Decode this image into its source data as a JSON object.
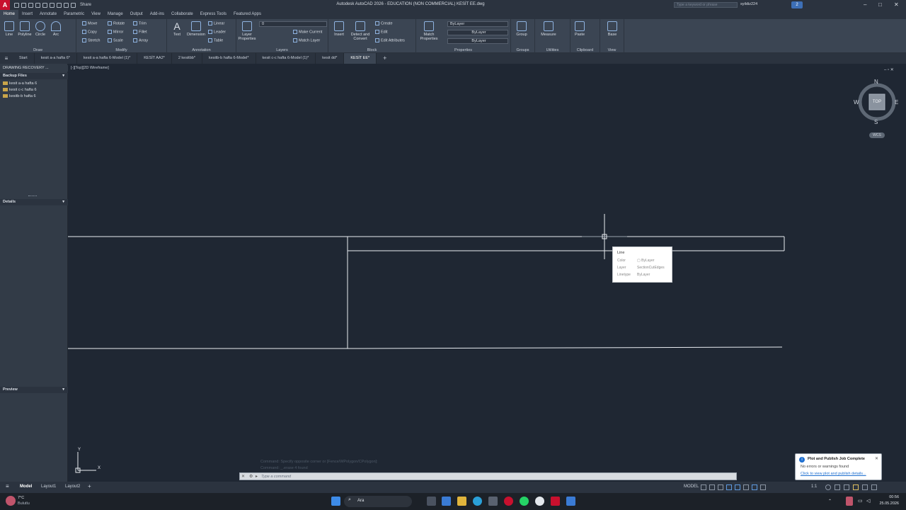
{
  "app": {
    "logo": "A",
    "title": "Autodesk AutoCAD 2026 - EDUCATION (NON COMMERCIAL)    KESİT EE.dwg",
    "share_label": "Share",
    "search_placeholder": "Type a keyword or phrase",
    "user": "syildiz224",
    "notif_badge": "2"
  },
  "ribbon_tabs": [
    "Home",
    "Insert",
    "Annotate",
    "Parametric",
    "View",
    "Manage",
    "Output",
    "Add-ins",
    "Collaborate",
    "Express Tools",
    "Featured Apps"
  ],
  "ribbon": {
    "draw": {
      "label": "Draw",
      "buttons": [
        "Line",
        "Polyline",
        "Circle",
        "Arc"
      ]
    },
    "modify": {
      "label": "Modify",
      "rows": [
        "Move",
        "Rotate",
        "Trim",
        "Copy",
        "Mirror",
        "Fillet",
        "Stretch",
        "Scale",
        "Array"
      ]
    },
    "annotation": {
      "label": "Annotation",
      "buttons": [
        "Text",
        "Dimension"
      ],
      "rows": [
        "Linear",
        "Leader",
        "Table"
      ]
    },
    "layers": {
      "label": "Layers",
      "props_label": "Layer Properties",
      "layer_value": "0",
      "rows": [
        "Make Current",
        "Match Layer"
      ]
    },
    "block": {
      "label": "Block",
      "buttons": [
        "Insert",
        "Detect and Convert"
      ],
      "rows": [
        "Create",
        "Edit",
        "Edit Attributes"
      ]
    },
    "properties": {
      "label": "Properties",
      "match_label": "Match Properties",
      "color": "ByLayer",
      "lineweight": "ByLayer",
      "linetype": "ByLayer"
    },
    "groups": {
      "label": "Groups",
      "button": "Group"
    },
    "utilities": {
      "label": "Utilities",
      "button": "Measure"
    },
    "clipboard": {
      "label": "Clipboard",
      "button": "Paste"
    },
    "view": {
      "label": "View",
      "button": "Base"
    }
  },
  "file_tabs": [
    "Start",
    "kesit a-a hafta 6*",
    "kesit a-a hafta 6-Model (1)*",
    "KESİT AA2*",
    "2 kesitbb*",
    "kesitb-b hafta 6-Model*",
    "kesit c-c hafta 6-Model (1)*",
    "kesit dd*",
    "KESİT EE*"
  ],
  "left_palette": {
    "title": "DRAWING RECOVERY ...",
    "backup_header": "Backup Files",
    "backup_files": [
      "kesit a-a hafta 6",
      "kesit c-c hafta 6",
      "kesitb-b hafta 6"
    ],
    "details_header": "Details",
    "preview_header": "Preview"
  },
  "viewport": {
    "label": "[-][Top][2D Wireframe]"
  },
  "viewcube": {
    "n": "N",
    "s": "S",
    "e": "E",
    "w": "W",
    "face": "TOP",
    "wcs": "WCS"
  },
  "tooltip": {
    "title": "Line",
    "rows": [
      {
        "key": "Color",
        "value": "ByLayer"
      },
      {
        "key": "Layer",
        "value": "SectionCutEdges"
      },
      {
        "key": "Linetype",
        "value": "ByLayer"
      }
    ]
  },
  "ucs": {
    "x": "X",
    "y": "Y"
  },
  "command": {
    "history": [
      "Command: Specify opposite corner or [Fence/WPolygon/CPolygon]:",
      "Command: _.erase 4 found"
    ],
    "placeholder": "Type a command"
  },
  "layout_tabs": [
    "Model",
    "Layout1",
    "Layout2"
  ],
  "status": {
    "model_label": "MODEL",
    "scale": "1:1"
  },
  "notification": {
    "title": "Plot and Publish Job Complete",
    "line1": "No errors or warnings found",
    "link": "Click to view plot and publish details..."
  },
  "taskbar": {
    "weather_temp": "7°C",
    "weather_desc": "Bulutlu",
    "search_label": "Ara",
    "time": "00:56",
    "date": "25.05.2026"
  },
  "colors": {
    "accent": "#0078d7",
    "brand": "#c8102e",
    "canvas": "#1f2733"
  }
}
